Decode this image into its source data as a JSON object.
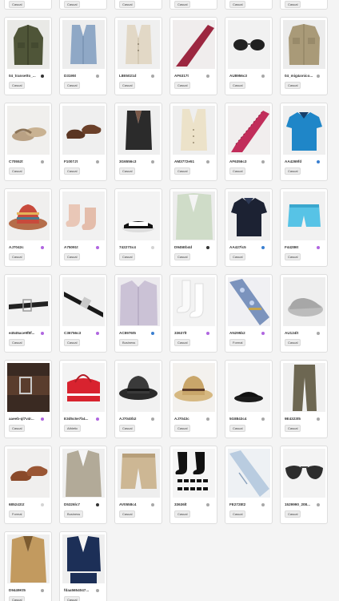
{
  "top_stubs": [
    {
      "tag": "Casual"
    },
    {
      "tag": "Casual"
    },
    {
      "tag": "Casual"
    },
    {
      "tag": "Casual"
    },
    {
      "tag": "Casual"
    },
    {
      "tag": "Casual"
    }
  ],
  "items": [
    {
      "name": "04_transetto_...",
      "tag": "Casual",
      "dot": "dark",
      "icon": "field-jacket-icon"
    },
    {
      "name": "D3195t",
      "tag": "Casual",
      "dot": "gray",
      "icon": "denim-vest-icon"
    },
    {
      "name": "L8E5021d",
      "tag": "Casual",
      "dot": "gray",
      "icon": "linen-vest-icon"
    },
    {
      "name": "AF6317t",
      "tag": "Casual",
      "dot": "gray",
      "icon": "red-tie-icon"
    },
    {
      "name": "AU8956c3",
      "tag": "Casual",
      "dot": "gray",
      "icon": "sunglasses-icon"
    },
    {
      "name": "04_mig&onico...",
      "tag": "Casual",
      "dot": "gray",
      "icon": "utility-jacket-icon"
    },
    {
      "name": "C70552t",
      "tag": "Casual",
      "dot": "gray",
      "icon": "sandal-icon"
    },
    {
      "name": "F1007Jt",
      "tag": "Casual",
      "dot": "gray",
      "icon": "brown-shoes-icon"
    },
    {
      "name": "3G6556c3",
      "tag": "Casual",
      "dot": "gray",
      "icon": "black-vest-icon"
    },
    {
      "name": "AM3772e51",
      "tag": "Casual",
      "dot": "gray",
      "icon": "cream-vest-icon"
    },
    {
      "name": "AF6356c3",
      "tag": "Casual",
      "dot": "gray",
      "icon": "pink-tie-icon"
    },
    {
      "name": "AA4269fd",
      "tag": "Casual",
      "dot": "blue",
      "icon": "blue-polo-icon"
    },
    {
      "name": "AJ7042c",
      "tag": "Casual",
      "dot": "purple",
      "icon": "striped-hat-icon"
    },
    {
      "name": "A75091t",
      "tag": "Casual",
      "dot": "purple",
      "icon": "socks-icon"
    },
    {
      "name": "74227Sc4",
      "tag": "Casual",
      "dot": "lgray",
      "icon": "slide-icon"
    },
    {
      "name": "D945Eb4d",
      "tag": "Casual",
      "dot": "dark",
      "icon": "sage-jacket-icon"
    },
    {
      "name": "AA427lc5",
      "tag": "Casual",
      "dot": "blue",
      "icon": "navy-polo-icon"
    },
    {
      "name": "F44286t",
      "tag": "Casual",
      "dot": "purple",
      "icon": "swim-shorts-icon"
    },
    {
      "name": "e4545ace9f8f...",
      "tag": "Casual",
      "dot": "purple",
      "icon": "belt-icon"
    },
    {
      "name": "C36756c3",
      "tag": "Casual",
      "dot": "purple",
      "icon": "black-belt-icon"
    },
    {
      "name": "AC8976t5",
      "tag": "Business",
      "dot": "blue",
      "icon": "dress-shirt-icon"
    },
    {
      "name": "33637lt",
      "tag": "Casual",
      "dot": "purple",
      "icon": "white-socks-icon"
    },
    {
      "name": "AN295b2",
      "tag": "Formal",
      "dot": "purple",
      "icon": "paisley-tie-icon"
    },
    {
      "name": "AU124lt",
      "tag": "Casual",
      "dot": "gray",
      "icon": "slipper-icon"
    },
    {
      "name": "aaeeb-ql7v4r...",
      "tag": "Casual",
      "dot": "purple",
      "icon": "leather-belt-icon"
    },
    {
      "name": "E3d5c5e7b4...",
      "tag": "Athletic",
      "dot": "purple",
      "icon": "duffel-bag-icon"
    },
    {
      "name": "AJ7040b2",
      "tag": "Casual",
      "dot": "gray",
      "icon": "fedora-icon"
    },
    {
      "name": "AJ7043c",
      "tag": "Casual",
      "dot": "gray",
      "icon": "straw-hat-icon"
    },
    {
      "name": "5G8843c4",
      "tag": "Casual",
      "dot": "gray",
      "icon": "black-slide-icon"
    },
    {
      "name": "9E4323t5",
      "tag": "Casual",
      "dot": "gray",
      "icon": "chino-pants-icon"
    },
    {
      "name": "6852431t",
      "tag": "Formal",
      "dot": "lgray",
      "icon": "oxford-shoes-icon"
    },
    {
      "name": "D5326lc7",
      "tag": "Business",
      "dot": "dark",
      "icon": "tweed-blazer-icon"
    },
    {
      "name": "AV0558c4",
      "tag": "Casual",
      "dot": "gray",
      "icon": "khaki-shorts-icon"
    },
    {
      "name": "33636lt",
      "tag": "Casual",
      "dot": "gray",
      "icon": "black-socks-icon"
    },
    {
      "name": "FE2728t2",
      "tag": "Casual",
      "dot": "gray",
      "icon": "blue-tie-icon"
    },
    {
      "name": "1529990_208...",
      "tag": "Casual",
      "dot": "gray",
      "icon": "aviator-icon"
    },
    {
      "name": "D9449Kt5",
      "tag": "Casual",
      "dot": "gray",
      "icon": "camel-blazer-icon"
    },
    {
      "name": "fdaa5654047...",
      "tag": "Casual",
      "dot": "gray",
      "icon": "navy-suit-icon"
    }
  ]
}
